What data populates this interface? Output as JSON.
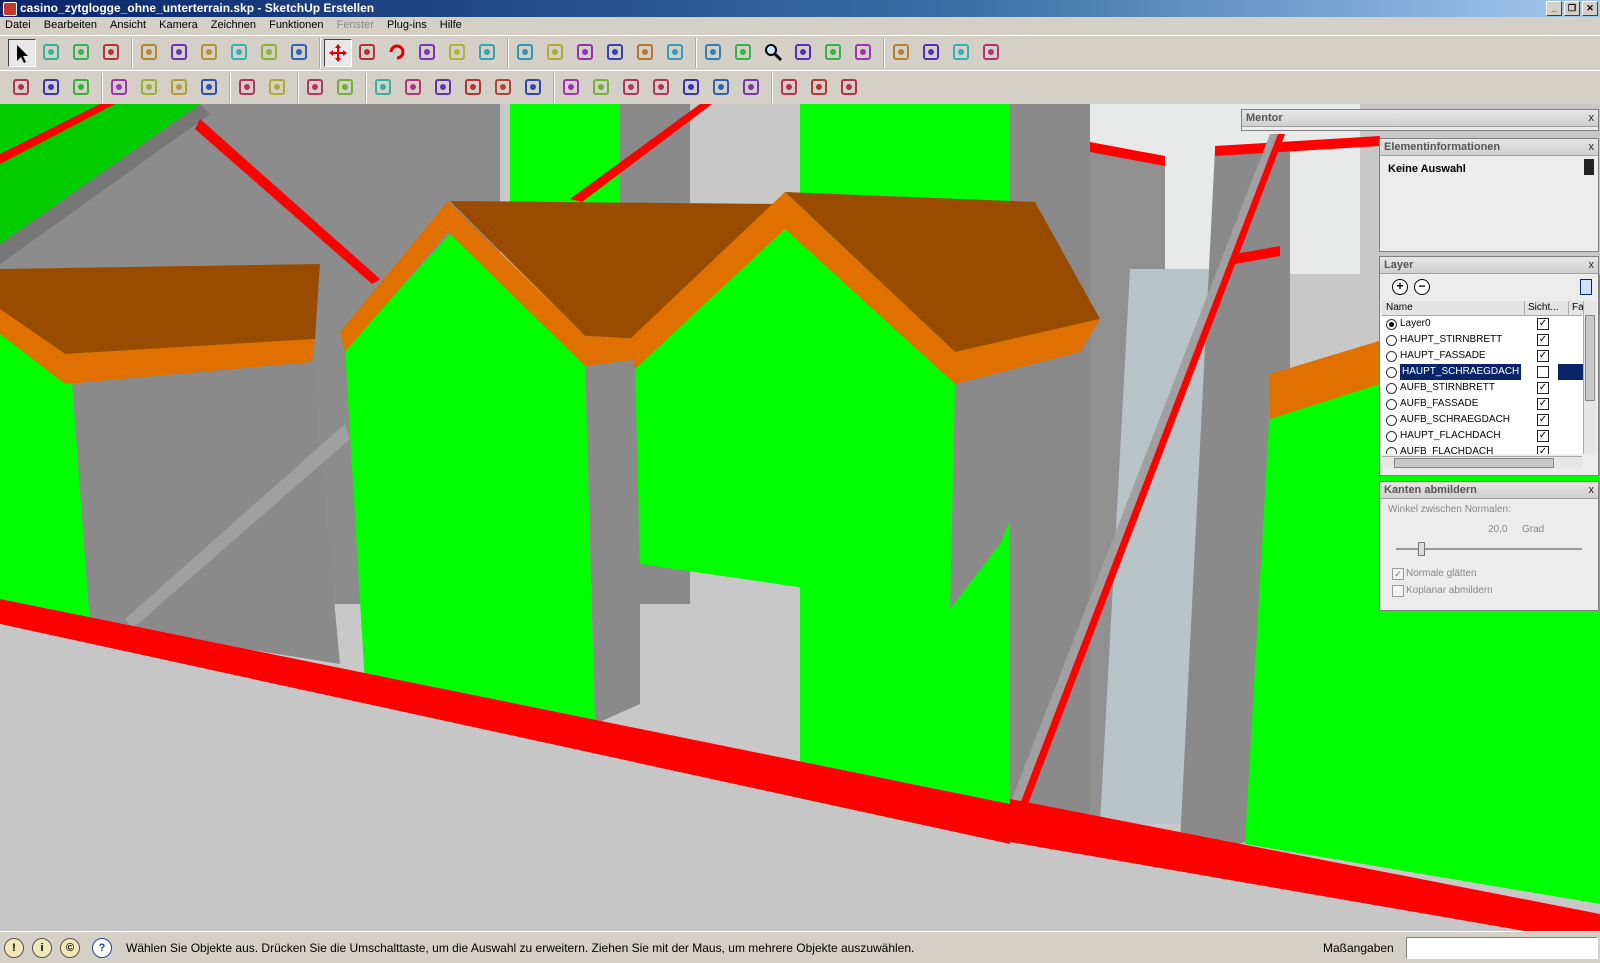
{
  "window": {
    "title": "casino_zytglogge_ohne_unterterrain.skp - SketchUp Erstellen",
    "buttons": [
      "_",
      "❐",
      "✕"
    ]
  },
  "menu": [
    {
      "label": "Datei",
      "enabled": true
    },
    {
      "label": "Bearbeiten",
      "enabled": true
    },
    {
      "label": "Ansicht",
      "enabled": true
    },
    {
      "label": "Kamera",
      "enabled": true
    },
    {
      "label": "Zeichnen",
      "enabled": true
    },
    {
      "label": "Funktionen",
      "enabled": true
    },
    {
      "label": "Fenster",
      "enabled": false
    },
    {
      "label": "Plug-ins",
      "enabled": true
    },
    {
      "label": "Hilfe",
      "enabled": true
    }
  ],
  "toolbar1": [
    "select-icon",
    "make-component-icon",
    "paint-bucket-icon",
    "eraser-icon",
    "rectangle-icon",
    "pencil-icon",
    "circle-icon",
    "arc-icon",
    "polygon-icon",
    "freehand-icon",
    "move-icon",
    "push-pull-icon",
    "rotate-icon",
    "follow-me-icon",
    "scale-icon",
    "offset-icon",
    "tape-measure-icon",
    "dimension-icon",
    "protractor-icon",
    "text-icon",
    "axes-icon",
    "3d-text-icon",
    "orbit-icon",
    "pan-icon",
    "zoom-icon",
    "zoom-window-icon",
    "zoom-extents-icon",
    "previous-view-icon",
    "position-camera-icon",
    "look-around-icon",
    "walk-icon",
    "section-plane-icon"
  ],
  "toolbar2": [
    "new-icon",
    "open-icon",
    "save-icon",
    "cut-icon",
    "copy-icon",
    "paste-icon",
    "delete-icon",
    "undo-icon",
    "redo-icon",
    "print-icon",
    "model-info-icon",
    "xray-icon",
    "back-edges-icon",
    "wireframe-icon",
    "hidden-line-icon",
    "shaded-icon",
    "shaded-textures-icon",
    "monochrome-icon",
    "iso-view-icon",
    "top-view-icon",
    "front-view-icon",
    "right-view-icon",
    "back-view-icon",
    "left-view-icon",
    "display-section-planes-icon",
    "display-section-cuts-icon",
    "sandbox-icon"
  ],
  "mentor": {
    "title": "Mentor",
    "close": "x"
  },
  "element_info": {
    "title": "Elementinformationen",
    "close": "x",
    "value": "Keine Auswahl"
  },
  "layers": {
    "title": "Layer",
    "close": "x",
    "col_name": "Name",
    "col_visible": "Sicht...",
    "col_color": "Fa",
    "rows": [
      {
        "name": "Layer0",
        "active": true,
        "visible": true,
        "selected": false
      },
      {
        "name": "HAUPT_STIRNBRETT",
        "active": false,
        "visible": true,
        "selected": false
      },
      {
        "name": "HAUPT_FASSADE",
        "active": false,
        "visible": true,
        "selected": false
      },
      {
        "name": "HAUPT_SCHRAEGDACH",
        "active": false,
        "visible": false,
        "selected": true
      },
      {
        "name": "AUFB_STIRNBRETT",
        "active": false,
        "visible": true,
        "selected": false
      },
      {
        "name": "AUFB_FASSADE",
        "active": false,
        "visible": true,
        "selected": false
      },
      {
        "name": "AUFB_SCHRAEGDACH",
        "active": false,
        "visible": true,
        "selected": false
      },
      {
        "name": "HAUPT_FLACHDACH",
        "active": false,
        "visible": true,
        "selected": false
      },
      {
        "name": "AUFB_FLACHDACH",
        "active": false,
        "visible": true,
        "selected": false
      }
    ]
  },
  "soften": {
    "title": "Kanten abmildern",
    "close": "x",
    "angle_label": "Winkel zwischen Normalen:",
    "angle_value": "20,0",
    "angle_unit": "Grad",
    "slider_fraction": 0.12,
    "smooth_label": "Normale glätten",
    "smooth_checked": true,
    "coplanar_label": "Koplanar abmildern",
    "coplanar_checked": false
  },
  "status": {
    "message": "Wählen Sie Objekte aus. Drücken Sie die Umschalttaste, um die Auswahl zu erweitern. Ziehen Sie mit der Maus, um mehrere Objekte auszuwählen.",
    "measure_label": "Maßangaben",
    "measure_value": "",
    "icons": [
      "georeference-icon",
      "credits-icon",
      "copyright-icon",
      "help-icon"
    ]
  },
  "colors": {
    "facade_green": "#00ff00",
    "roof_brown": "#994c00",
    "trim_orange": "#e07000",
    "edge_red": "#ff0000",
    "wall_grey": "#8a8a8a"
  }
}
